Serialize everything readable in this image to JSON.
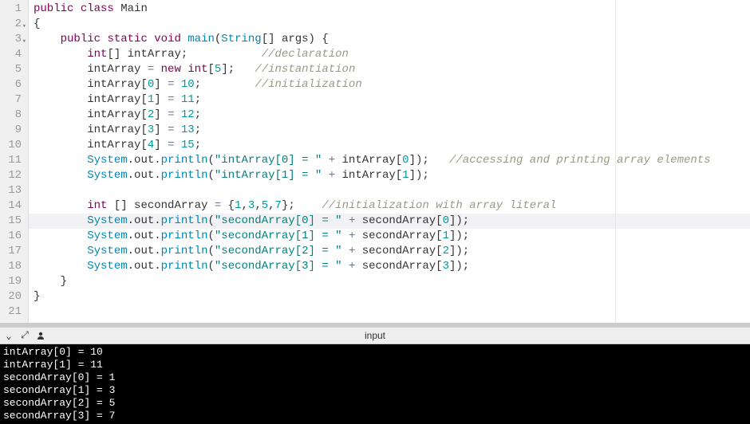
{
  "editor": {
    "lines": [
      {
        "num": "1",
        "fold": false,
        "hl": false,
        "tokens": [
          {
            "t": "public",
            "c": "kw"
          },
          {
            "t": " ",
            "c": ""
          },
          {
            "t": "class",
            "c": "kw"
          },
          {
            "t": " ",
            "c": ""
          },
          {
            "t": "Main",
            "c": "cls"
          }
        ]
      },
      {
        "num": "2",
        "fold": true,
        "hl": false,
        "tokens": [
          {
            "t": "{",
            "c": "punct"
          }
        ]
      },
      {
        "num": "3",
        "fold": true,
        "hl": false,
        "tokens": [
          {
            "t": "    ",
            "c": ""
          },
          {
            "t": "public",
            "c": "kw"
          },
          {
            "t": " ",
            "c": ""
          },
          {
            "t": "static",
            "c": "kw"
          },
          {
            "t": " ",
            "c": ""
          },
          {
            "t": "void",
            "c": "kw"
          },
          {
            "t": " ",
            "c": ""
          },
          {
            "t": "main",
            "c": "method"
          },
          {
            "t": "(",
            "c": "punct"
          },
          {
            "t": "String",
            "c": "type"
          },
          {
            "t": "[] ",
            "c": "punct"
          },
          {
            "t": "args",
            "c": "ident"
          },
          {
            "t": ") {",
            "c": "punct"
          }
        ]
      },
      {
        "num": "4",
        "fold": false,
        "hl": false,
        "tokens": [
          {
            "t": "        ",
            "c": ""
          },
          {
            "t": "int",
            "c": "kw"
          },
          {
            "t": "[] ",
            "c": "punct"
          },
          {
            "t": "intArray",
            "c": "ident"
          },
          {
            "t": ";           ",
            "c": "punct"
          },
          {
            "t": "//declaration",
            "c": "cmt"
          }
        ]
      },
      {
        "num": "5",
        "fold": false,
        "hl": false,
        "tokens": [
          {
            "t": "        ",
            "c": ""
          },
          {
            "t": "intArray",
            "c": "ident"
          },
          {
            "t": " ",
            "c": ""
          },
          {
            "t": "=",
            "c": "op"
          },
          {
            "t": " ",
            "c": ""
          },
          {
            "t": "new",
            "c": "kw"
          },
          {
            "t": " ",
            "c": ""
          },
          {
            "t": "int",
            "c": "kw"
          },
          {
            "t": "[",
            "c": "punct"
          },
          {
            "t": "5",
            "c": "num"
          },
          {
            "t": "];   ",
            "c": "punct"
          },
          {
            "t": "//instantiation",
            "c": "cmt"
          }
        ]
      },
      {
        "num": "6",
        "fold": false,
        "hl": false,
        "tokens": [
          {
            "t": "        ",
            "c": ""
          },
          {
            "t": "intArray",
            "c": "ident"
          },
          {
            "t": "[",
            "c": "punct"
          },
          {
            "t": "0",
            "c": "num"
          },
          {
            "t": "] ",
            "c": "punct"
          },
          {
            "t": "=",
            "c": "op"
          },
          {
            "t": " ",
            "c": ""
          },
          {
            "t": "10",
            "c": "num"
          },
          {
            "t": ";        ",
            "c": "punct"
          },
          {
            "t": "//initialization",
            "c": "cmt"
          }
        ]
      },
      {
        "num": "7",
        "fold": false,
        "hl": false,
        "tokens": [
          {
            "t": "        ",
            "c": ""
          },
          {
            "t": "intArray",
            "c": "ident"
          },
          {
            "t": "[",
            "c": "punct"
          },
          {
            "t": "1",
            "c": "num"
          },
          {
            "t": "] ",
            "c": "punct"
          },
          {
            "t": "=",
            "c": "op"
          },
          {
            "t": " ",
            "c": ""
          },
          {
            "t": "11",
            "c": "num"
          },
          {
            "t": ";",
            "c": "punct"
          }
        ]
      },
      {
        "num": "8",
        "fold": false,
        "hl": false,
        "tokens": [
          {
            "t": "        ",
            "c": ""
          },
          {
            "t": "intArray",
            "c": "ident"
          },
          {
            "t": "[",
            "c": "punct"
          },
          {
            "t": "2",
            "c": "num"
          },
          {
            "t": "] ",
            "c": "punct"
          },
          {
            "t": "=",
            "c": "op"
          },
          {
            "t": " ",
            "c": ""
          },
          {
            "t": "12",
            "c": "num"
          },
          {
            "t": ";",
            "c": "punct"
          }
        ]
      },
      {
        "num": "9",
        "fold": false,
        "hl": false,
        "tokens": [
          {
            "t": "        ",
            "c": ""
          },
          {
            "t": "intArray",
            "c": "ident"
          },
          {
            "t": "[",
            "c": "punct"
          },
          {
            "t": "3",
            "c": "num"
          },
          {
            "t": "] ",
            "c": "punct"
          },
          {
            "t": "=",
            "c": "op"
          },
          {
            "t": " ",
            "c": ""
          },
          {
            "t": "13",
            "c": "num"
          },
          {
            "t": ";",
            "c": "punct"
          }
        ]
      },
      {
        "num": "10",
        "fold": false,
        "hl": false,
        "tokens": [
          {
            "t": "        ",
            "c": ""
          },
          {
            "t": "intArray",
            "c": "ident"
          },
          {
            "t": "[",
            "c": "punct"
          },
          {
            "t": "4",
            "c": "num"
          },
          {
            "t": "] ",
            "c": "punct"
          },
          {
            "t": "=",
            "c": "op"
          },
          {
            "t": " ",
            "c": ""
          },
          {
            "t": "15",
            "c": "num"
          },
          {
            "t": ";",
            "c": "punct"
          }
        ]
      },
      {
        "num": "11",
        "fold": false,
        "hl": false,
        "tokens": [
          {
            "t": "        ",
            "c": ""
          },
          {
            "t": "System",
            "c": "type"
          },
          {
            "t": ".",
            "c": "punct"
          },
          {
            "t": "out",
            "c": "ident"
          },
          {
            "t": ".",
            "c": "punct"
          },
          {
            "t": "println",
            "c": "method"
          },
          {
            "t": "(",
            "c": "punct"
          },
          {
            "t": "\"intArray[0] = \"",
            "c": "str2"
          },
          {
            "t": " ",
            "c": ""
          },
          {
            "t": "+",
            "c": "op"
          },
          {
            "t": " ",
            "c": ""
          },
          {
            "t": "intArray",
            "c": "ident"
          },
          {
            "t": "[",
            "c": "punct"
          },
          {
            "t": "0",
            "c": "num"
          },
          {
            "t": "]);   ",
            "c": "punct"
          },
          {
            "t": "//accessing and printing array elements",
            "c": "cmt"
          }
        ]
      },
      {
        "num": "12",
        "fold": false,
        "hl": false,
        "tokens": [
          {
            "t": "        ",
            "c": ""
          },
          {
            "t": "System",
            "c": "type"
          },
          {
            "t": ".",
            "c": "punct"
          },
          {
            "t": "out",
            "c": "ident"
          },
          {
            "t": ".",
            "c": "punct"
          },
          {
            "t": "println",
            "c": "method"
          },
          {
            "t": "(",
            "c": "punct"
          },
          {
            "t": "\"intArray[1] = \"",
            "c": "str2"
          },
          {
            "t": " ",
            "c": ""
          },
          {
            "t": "+",
            "c": "op"
          },
          {
            "t": " ",
            "c": ""
          },
          {
            "t": "intArray",
            "c": "ident"
          },
          {
            "t": "[",
            "c": "punct"
          },
          {
            "t": "1",
            "c": "num"
          },
          {
            "t": "]);",
            "c": "punct"
          }
        ]
      },
      {
        "num": "13",
        "fold": false,
        "hl": false,
        "tokens": []
      },
      {
        "num": "14",
        "fold": false,
        "hl": false,
        "tokens": [
          {
            "t": "        ",
            "c": ""
          },
          {
            "t": "int",
            "c": "kw"
          },
          {
            "t": " [] ",
            "c": "punct"
          },
          {
            "t": "secondArray",
            "c": "ident"
          },
          {
            "t": " ",
            "c": ""
          },
          {
            "t": "=",
            "c": "op"
          },
          {
            "t": " {",
            "c": "punct"
          },
          {
            "t": "1",
            "c": "num"
          },
          {
            "t": ",",
            "c": "punct"
          },
          {
            "t": "3",
            "c": "num"
          },
          {
            "t": ",",
            "c": "punct"
          },
          {
            "t": "5",
            "c": "num"
          },
          {
            "t": ",",
            "c": "punct"
          },
          {
            "t": "7",
            "c": "num"
          },
          {
            "t": "};    ",
            "c": "punct"
          },
          {
            "t": "//initialization with array literal",
            "c": "cmt"
          }
        ]
      },
      {
        "num": "15",
        "fold": false,
        "hl": true,
        "tokens": [
          {
            "t": "        ",
            "c": ""
          },
          {
            "t": "System",
            "c": "type"
          },
          {
            "t": ".",
            "c": "punct"
          },
          {
            "t": "out",
            "c": "ident"
          },
          {
            "t": ".",
            "c": "punct"
          },
          {
            "t": "println",
            "c": "method"
          },
          {
            "t": "(",
            "c": "punct"
          },
          {
            "t": "\"secondArray[0] = \"",
            "c": "str2"
          },
          {
            "t": " ",
            "c": ""
          },
          {
            "t": "+",
            "c": "op"
          },
          {
            "t": " ",
            "c": ""
          },
          {
            "t": "secondArray",
            "c": "ident"
          },
          {
            "t": "[",
            "c": "punct"
          },
          {
            "t": "0",
            "c": "num"
          },
          {
            "t": "]);",
            "c": "punct"
          }
        ]
      },
      {
        "num": "16",
        "fold": false,
        "hl": false,
        "tokens": [
          {
            "t": "        ",
            "c": ""
          },
          {
            "t": "System",
            "c": "type"
          },
          {
            "t": ".",
            "c": "punct"
          },
          {
            "t": "out",
            "c": "ident"
          },
          {
            "t": ".",
            "c": "punct"
          },
          {
            "t": "println",
            "c": "method"
          },
          {
            "t": "(",
            "c": "punct"
          },
          {
            "t": "\"secondArray[1] = \"",
            "c": "str2"
          },
          {
            "t": " ",
            "c": ""
          },
          {
            "t": "+",
            "c": "op"
          },
          {
            "t": " ",
            "c": ""
          },
          {
            "t": "secondArray",
            "c": "ident"
          },
          {
            "t": "[",
            "c": "punct"
          },
          {
            "t": "1",
            "c": "num"
          },
          {
            "t": "]);",
            "c": "punct"
          }
        ]
      },
      {
        "num": "17",
        "fold": false,
        "hl": false,
        "tokens": [
          {
            "t": "        ",
            "c": ""
          },
          {
            "t": "System",
            "c": "type"
          },
          {
            "t": ".",
            "c": "punct"
          },
          {
            "t": "out",
            "c": "ident"
          },
          {
            "t": ".",
            "c": "punct"
          },
          {
            "t": "println",
            "c": "method"
          },
          {
            "t": "(",
            "c": "punct"
          },
          {
            "t": "\"secondArray[2] = \"",
            "c": "str2"
          },
          {
            "t": " ",
            "c": ""
          },
          {
            "t": "+",
            "c": "op"
          },
          {
            "t": " ",
            "c": ""
          },
          {
            "t": "secondArray",
            "c": "ident"
          },
          {
            "t": "[",
            "c": "punct"
          },
          {
            "t": "2",
            "c": "num"
          },
          {
            "t": "]);",
            "c": "punct"
          }
        ]
      },
      {
        "num": "18",
        "fold": false,
        "hl": false,
        "tokens": [
          {
            "t": "        ",
            "c": ""
          },
          {
            "t": "System",
            "c": "type"
          },
          {
            "t": ".",
            "c": "punct"
          },
          {
            "t": "out",
            "c": "ident"
          },
          {
            "t": ".",
            "c": "punct"
          },
          {
            "t": "println",
            "c": "method"
          },
          {
            "t": "(",
            "c": "punct"
          },
          {
            "t": "\"secondArray[3] = \"",
            "c": "str2"
          },
          {
            "t": " ",
            "c": ""
          },
          {
            "t": "+",
            "c": "op"
          },
          {
            "t": " ",
            "c": ""
          },
          {
            "t": "secondArray",
            "c": "ident"
          },
          {
            "t": "[",
            "c": "punct"
          },
          {
            "t": "3",
            "c": "num"
          },
          {
            "t": "]);",
            "c": "punct"
          }
        ]
      },
      {
        "num": "19",
        "fold": false,
        "hl": false,
        "tokens": [
          {
            "t": "    }",
            "c": "punct"
          }
        ]
      },
      {
        "num": "20",
        "fold": false,
        "hl": false,
        "tokens": [
          {
            "t": "}",
            "c": "punct"
          }
        ]
      },
      {
        "num": "21",
        "fold": false,
        "hl": false,
        "tokens": []
      }
    ]
  },
  "toolbar": {
    "input_label": "input",
    "icons": {
      "collapse": "⌄",
      "expand": "⤢",
      "person": "👤"
    }
  },
  "console": {
    "lines": [
      "intArray[0] = 10",
      "intArray[1] = 11",
      "secondArray[0] = 1",
      "secondArray[1] = 3",
      "secondArray[2] = 5",
      "secondArray[3] = 7"
    ]
  }
}
